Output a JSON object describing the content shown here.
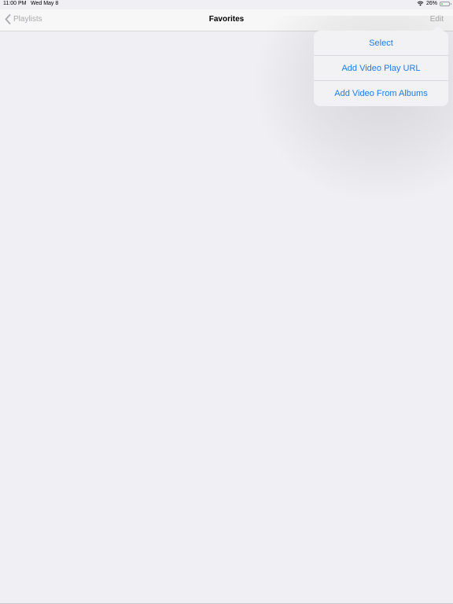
{
  "status_bar": {
    "time": "11:00 PM",
    "date": "Wed May 8",
    "battery_percent": "26%",
    "battery_level": 0.26,
    "wifi_icon": "wifi-icon",
    "battery_icon": "battery-icon"
  },
  "nav_bar": {
    "back_label": "Playlists",
    "back_icon": "chevron-left-icon",
    "title": "Favorites",
    "edit_label": "Edit"
  },
  "popover_menu": {
    "items": [
      {
        "label": "Select"
      },
      {
        "label": "Add Video Play URL"
      },
      {
        "label": "Add Video From Albums"
      }
    ]
  },
  "colors": {
    "accent": "#1a7cf2",
    "background": "#efeff4",
    "disabled_text": "#a9a9ae"
  }
}
